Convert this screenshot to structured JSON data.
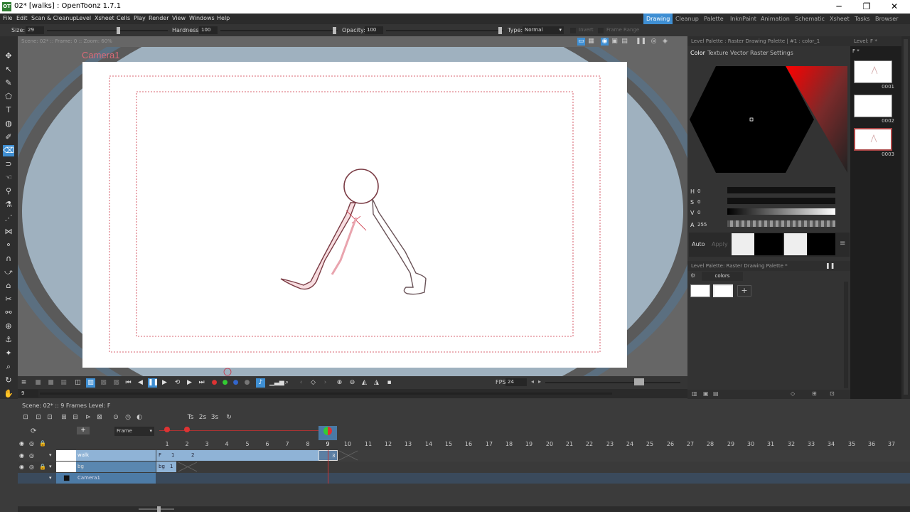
{
  "window": {
    "title": "02* [walks] : OpenToonz 1.7.1",
    "logo": "OT",
    "minimize": "─",
    "restore": "❐",
    "close": "✕"
  },
  "menu": [
    "File",
    "Edit",
    "Scan & Cleanup",
    "Level",
    "Xsheet",
    "Cells",
    "Play",
    "Render",
    "View",
    "Windows",
    "Help"
  ],
  "rooms": [
    "Drawing",
    "Cleanup",
    "Palette",
    "InknPaint",
    "Animation",
    "Schematic",
    "Xsheet",
    "Tasks",
    "Browser"
  ],
  "active_room": "Drawing",
  "tool_options": {
    "size_label": "Size:",
    "size": "29",
    "hardness_label": "Hardness:",
    "hardness": "100",
    "opacity_label": "Opacity:",
    "opacity": "100",
    "type_label": "Type:",
    "type": "Normal",
    "invert": "Invert",
    "frame_range": "Frame Range"
  },
  "viewer": {
    "info": "Scene: 02*  ::  Frame: 0  ::  Zoom: 60%",
    "camera_label": "Camera1"
  },
  "playbar": {
    "fps_label": "FPS",
    "fps": "24"
  },
  "framebar": {
    "frame": "9"
  },
  "palette_panel": {
    "header": "Level Palette : Raster Drawing Palette | #1 : color_1",
    "tabs": [
      "Color",
      "Texture",
      "Vector",
      "Raster",
      "Settings"
    ],
    "channels": [
      {
        "label": "H",
        "value": "0"
      },
      {
        "label": "S",
        "value": "0"
      },
      {
        "label": "V",
        "value": "0"
      },
      {
        "label": "A",
        "value": "255"
      }
    ],
    "auto": "Auto",
    "apply": "Apply",
    "palette_header": "Level Palette: Raster Drawing Palette *",
    "page_tab": "colors",
    "add": "+"
  },
  "level_strip": {
    "header": "Level:  F *",
    "sub": "F *",
    "frames": [
      "0001",
      "0002",
      "0003"
    ]
  },
  "xsheet": {
    "scene_info": "Scene: 02*  ::  9 Frames  Level: F",
    "mode": "Frame",
    "frame_numbers": [
      "1",
      "2",
      "3",
      "4",
      "5",
      "6",
      "7",
      "8",
      "9",
      "10",
      "11",
      "12",
      "13",
      "14",
      "15",
      "16",
      "17",
      "18",
      "19",
      "20",
      "21",
      "22",
      "23",
      "24",
      "25",
      "26",
      "27",
      "28",
      "29",
      "30",
      "31",
      "32",
      "33",
      "34",
      "35",
      "36",
      "37"
    ],
    "layers": [
      {
        "name": "walk"
      },
      {
        "name": "bg"
      },
      {
        "name": "Camera1"
      }
    ],
    "walk_cells": [
      "F",
      "1",
      "2",
      "3"
    ],
    "bg_cells": [
      "bg",
      "1"
    ]
  },
  "colors": {
    "accent": "#3f8fd3",
    "camera_red": "#cc3344",
    "layer_blue": "#8fb3d6",
    "background_gray": "#666666"
  }
}
